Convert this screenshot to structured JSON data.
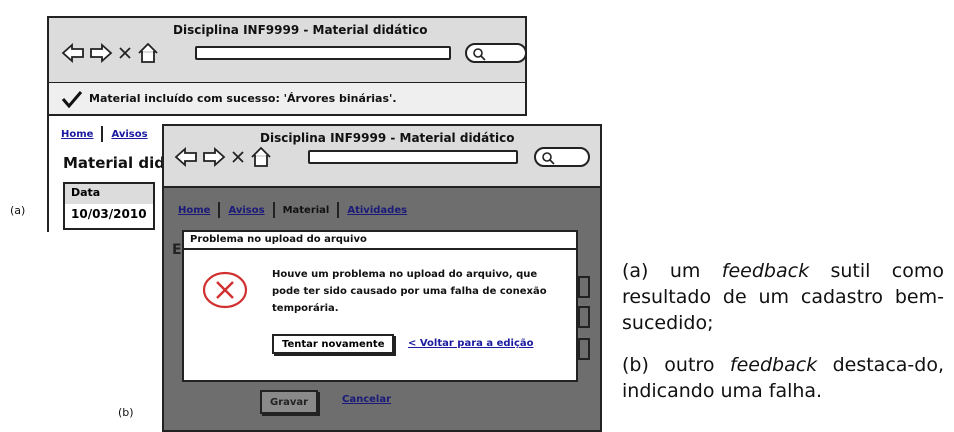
{
  "panel_a": {
    "label": "(a)",
    "window_title": "Disciplina INF9999 - Material didático",
    "success_message": "Material incluído com sucesso: 'Árvores binárias'.",
    "nav_links": [
      "Home",
      "Avisos"
    ],
    "heading": "Material didá",
    "table": {
      "header": "Data",
      "row": "10/03/2010"
    }
  },
  "panel_b": {
    "label": "(b)",
    "window_title": "Disciplina INF9999 - Material didático",
    "nav_links": [
      "Home",
      "Avisos",
      "Material",
      "Atividades"
    ],
    "dialog": {
      "title": "Problema no upload do arquivo",
      "message": "Houve um problema no upload do arquivo, que pode ter sido causado por uma falha de conexão temporária.",
      "retry_label": "Tentar novamente",
      "back_label": "< Voltar para a edição"
    },
    "save_label": "Gravar",
    "cancel_label": "Cancelar",
    "ghost_letter": "E"
  },
  "caption": {
    "a_prefix": "(a) um ",
    "a_emph": "feedback",
    "a_rest": " sutil como resultado de um cadastro bem-sucedido;",
    "b_prefix": "(b) outro ",
    "b_emph": "feedback",
    "b_rest": " destaca-do, indicando uma falha."
  },
  "colors": {
    "link": "#1a1aa0",
    "error": "#d23030",
    "overlay": "#6e6e6e",
    "chrome": "#dcdcdc"
  }
}
